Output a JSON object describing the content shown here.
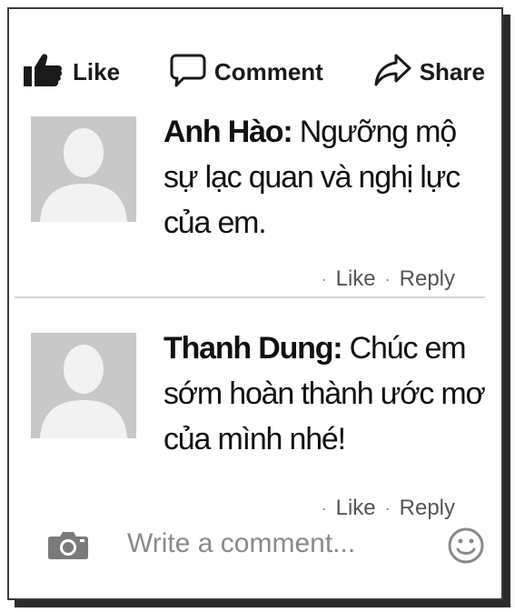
{
  "actions": {
    "like_label": "Like",
    "comment_label": "Comment",
    "share_label": "Share"
  },
  "comments": [
    {
      "author": "Anh Hào:",
      "lines": [
        "Ngưỡng mộ",
        "sự lạc quan và nghị lực",
        "của em."
      ],
      "like_label": "Like",
      "reply_label": "Reply"
    },
    {
      "author": "Thanh Dung:",
      "lines": [
        "Chúc em",
        "sớm hoàn thành ước mơ",
        "của mình nhé!"
      ],
      "like_label": "Like",
      "reply_label": "Reply"
    }
  ],
  "composer": {
    "placeholder": "Write a comment..."
  },
  "icons": {
    "like": "thumbs-up-icon",
    "comment": "speech-bubble-icon",
    "share": "share-arrow-icon",
    "camera": "camera-icon",
    "emoji": "smiley-icon"
  }
}
